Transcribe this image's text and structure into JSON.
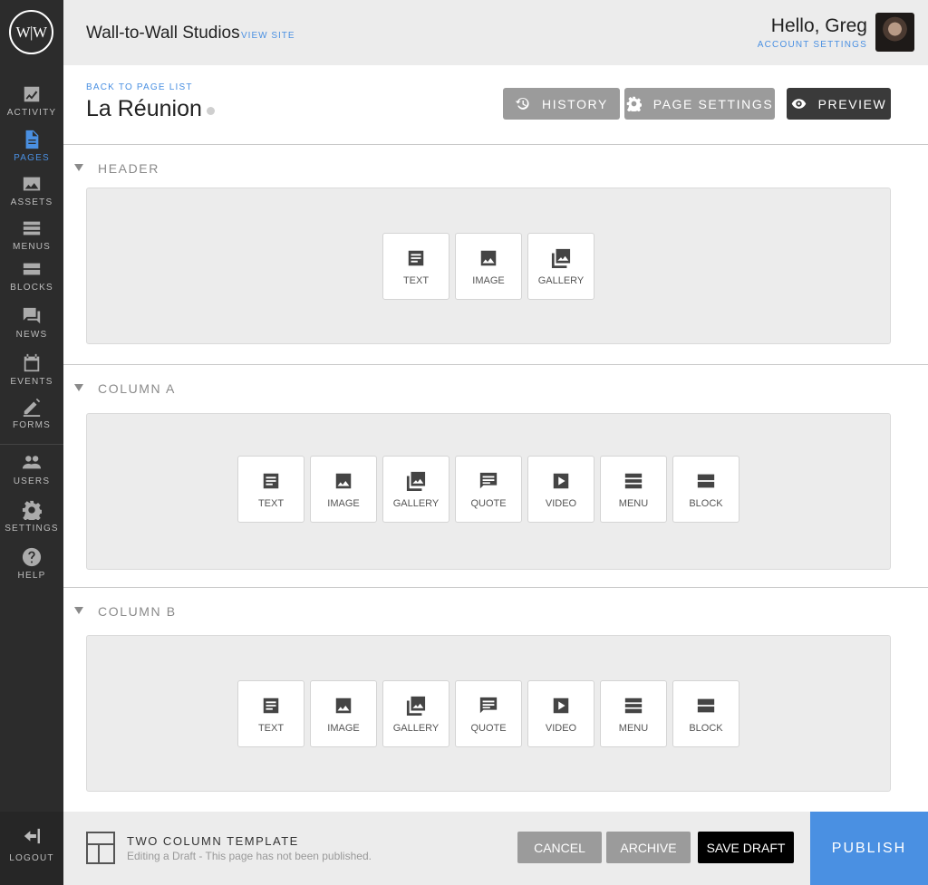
{
  "brand": {
    "logo_text": "W|W",
    "accent": "#4a90e2"
  },
  "sidebar": {
    "items": [
      {
        "label": "ACTIVITY",
        "icon": "activity-chart-icon"
      },
      {
        "label": "PAGES",
        "icon": "page-file-icon",
        "active": true
      },
      {
        "label": "ASSETS",
        "icon": "image-icon"
      },
      {
        "label": "MENUS",
        "icon": "menu-list-icon"
      },
      {
        "label": "BLOCKS",
        "icon": "blocks-icon"
      },
      {
        "label": "NEWS",
        "icon": "news-chat-icon"
      },
      {
        "label": "EVENTS",
        "icon": "calendar-icon"
      },
      {
        "label": "FORMS",
        "icon": "pencil-icon"
      },
      {
        "label": "USERS",
        "icon": "users-icon"
      },
      {
        "label": "SETTINGS",
        "icon": "gear-icon"
      },
      {
        "label": "HELP",
        "icon": "help-icon"
      }
    ],
    "logout_label": "LOGOUT"
  },
  "topbar": {
    "site_name": "Wall-to-Wall Studios",
    "view_site": "VIEW SITE",
    "greeting": "Hello, Greg",
    "account_settings": "ACCOUNT SETTINGS"
  },
  "page": {
    "back_link": "BACK TO PAGE LIST",
    "title": "La Réunion",
    "buttons": {
      "history": "HISTORY",
      "page_settings": "PAGE SETTINGS",
      "preview": "PREVIEW"
    }
  },
  "sections": [
    {
      "label": "HEADER",
      "tiles": [
        "TEXT",
        "IMAGE",
        "GALLERY"
      ]
    },
    {
      "label": "COLUMN A",
      "tiles": [
        "TEXT",
        "IMAGE",
        "GALLERY",
        "QUOTE",
        "VIDEO",
        "MENU",
        "BLOCK"
      ]
    },
    {
      "label": "COLUMN B",
      "tiles": [
        "TEXT",
        "IMAGE",
        "GALLERY",
        "QUOTE",
        "VIDEO",
        "MENU",
        "BLOCK"
      ]
    }
  ],
  "footer": {
    "template_name": "TWO COLUMN TEMPLATE",
    "template_status": "Editing a Draft - This page has not been published.",
    "cancel": "CANCEL",
    "archive": "ARCHIVE",
    "save_draft": "SAVE DRAFT",
    "publish": "PUBLISH"
  }
}
